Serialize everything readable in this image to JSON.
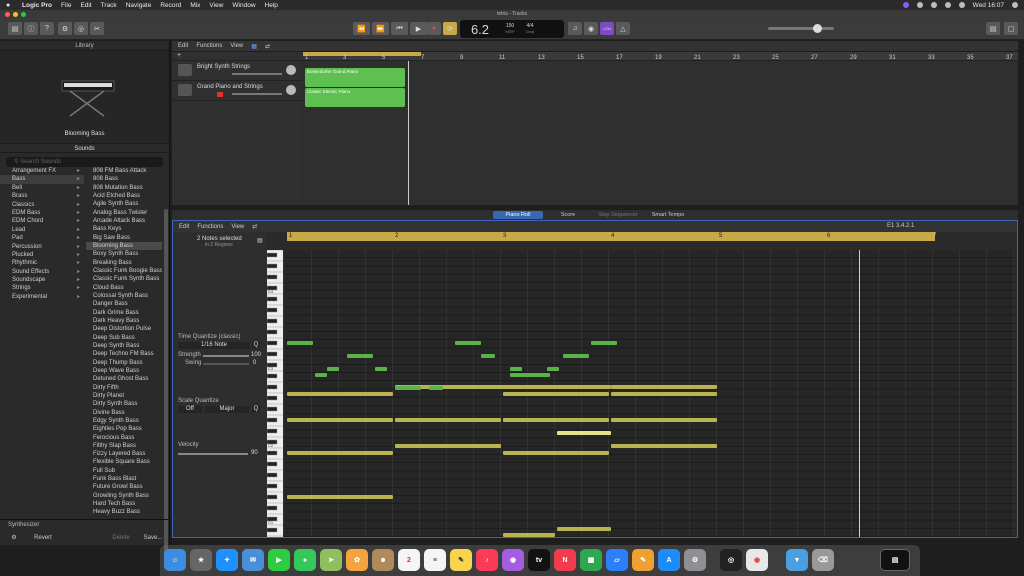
{
  "menubar": {
    "items": [
      "Logic Pro",
      "File",
      "Edit",
      "Track",
      "Navigate",
      "Record",
      "Mix",
      "View",
      "Window",
      "Help"
    ],
    "clock": "Wed 16:07"
  },
  "window": {
    "title": "tetris - Tracks"
  },
  "lcd": {
    "position": "6.2",
    "bar_label": "BAR",
    "beat_label": "BEAT",
    "tempo": "150",
    "tempo_label": "KEEP",
    "signature": "4/4",
    "key": "Cmaj",
    "count_in": "♪234"
  },
  "library": {
    "header": "Library",
    "instrument_name": "Blooming Bass",
    "sounds_header": "Sounds",
    "search_placeholder": "Search Sounds",
    "categories": [
      "Arrangement FX",
      "Bass",
      "Bell",
      "Brass",
      "Classics",
      "EDM Bass",
      "EDM Chord",
      "Lead",
      "Pad",
      "Percussion",
      "Plucked",
      "Rhythmic",
      "Sound Effects",
      "Soundscape",
      "Strings",
      "Experimental"
    ],
    "sounds": [
      "808 FM Bass Attack",
      "808 Bass",
      "808 Mutation Bass",
      "Acid Etched Bass",
      "Agile Synth Bass",
      "Analog Bass Twister",
      "Arcade Attack Bass",
      "Bass Keys",
      "Big Saw Bass",
      "Blooming Bass",
      "Boxy Synth Bass",
      "Breaking Bass",
      "Classic Funk Boogie Bass",
      "Classic Funk Synth Bass",
      "Cloud Bass",
      "Colossal Synth Bass",
      "Danger Bass",
      "Dark Grime Bass",
      "Dark Heavy Bass",
      "Deep Distortion Pulse",
      "Deep Sub Bass",
      "Deep Synth Bass",
      "Deep Techno FM Bass",
      "Deep Thump Bass",
      "Deep Wave Bass",
      "Detuned Ghost Bass",
      "Dirty Fifth",
      "Dirty Planet",
      "Dirty Synth Bass",
      "Divine Bass",
      "Edgy Synth Bass",
      "Eighties Pop Bass",
      "Ferocious Bass",
      "Filthy Slap Bass",
      "Fizzy Layered Bass",
      "Flexible Square Bass",
      "Full Sub",
      "Funk Bass Blast",
      "Future Growl Bass",
      "Growling Synth Bass",
      "Hard Tech Bass",
      "Heavy Buzz Bass"
    ],
    "footer_label": "Synthesizer",
    "revert": "Revert",
    "delete": "Delete",
    "save": "Save..."
  },
  "tracks_toolbar": {
    "edit": "Edit",
    "functions": "Functions",
    "view": "View"
  },
  "ruler_numbers": [
    "1",
    "3",
    "5",
    "7",
    "9",
    "11",
    "13",
    "15",
    "17",
    "19",
    "21",
    "23",
    "25",
    "27",
    "29",
    "31",
    "33",
    "35",
    "37"
  ],
  "tracks": [
    {
      "name": "Bright Synth Strings",
      "region": "Bosendorfer Grand Piano"
    },
    {
      "name": "Grand Piano and Strings",
      "region": "Classic Electric Piano"
    }
  ],
  "editor_tabs": [
    "Piano Roll",
    "Score",
    "Step Sequencer",
    "Smart Tempo"
  ],
  "piano_roll": {
    "edit": "Edit",
    "functions": "Functions",
    "view": "View",
    "selection_info": "2 Notes selected",
    "selection_sub": "in 2 Regions",
    "position": "E1  3.4.2.1",
    "time_quantize_label": "Time Quantize (classic)",
    "quantize_value": "1/16 Note",
    "q_button": "Q",
    "strength_label": "Strength",
    "strength_value": "100",
    "swing_label": "Swing",
    "swing_value": "0",
    "scale_quantize_label": "Scale Quantize",
    "scale_off": "Off",
    "scale_major": "Major",
    "velocity_label": "Velocity",
    "velocity_value": "90",
    "ruler_numbers": [
      "1",
      "2",
      "3",
      "4",
      "5",
      "6",
      "7"
    ],
    "key_labels": [
      "C4",
      "C3",
      "C2",
      "C1"
    ]
  },
  "dock_apps": [
    "Finder",
    "Launchpad",
    "Safari",
    "Mail",
    "FaceTime",
    "Messages",
    "Maps",
    "Photos",
    "Contacts",
    "Calendar",
    "Reminders",
    "Notes",
    "Music",
    "Podcasts",
    "TV",
    "News",
    "Numbers",
    "Keynote",
    "Pages",
    "App Store",
    "System Preferences",
    "Logic Pro",
    "Chrome",
    "Downloads",
    "Trash",
    "Screenshot"
  ],
  "colors": {
    "accent": "#3768b0",
    "region_green": "#5ec050",
    "note_yellow": "#b9b44f",
    "note_green": "#59b349",
    "ruler_gold": "#c9a947"
  }
}
